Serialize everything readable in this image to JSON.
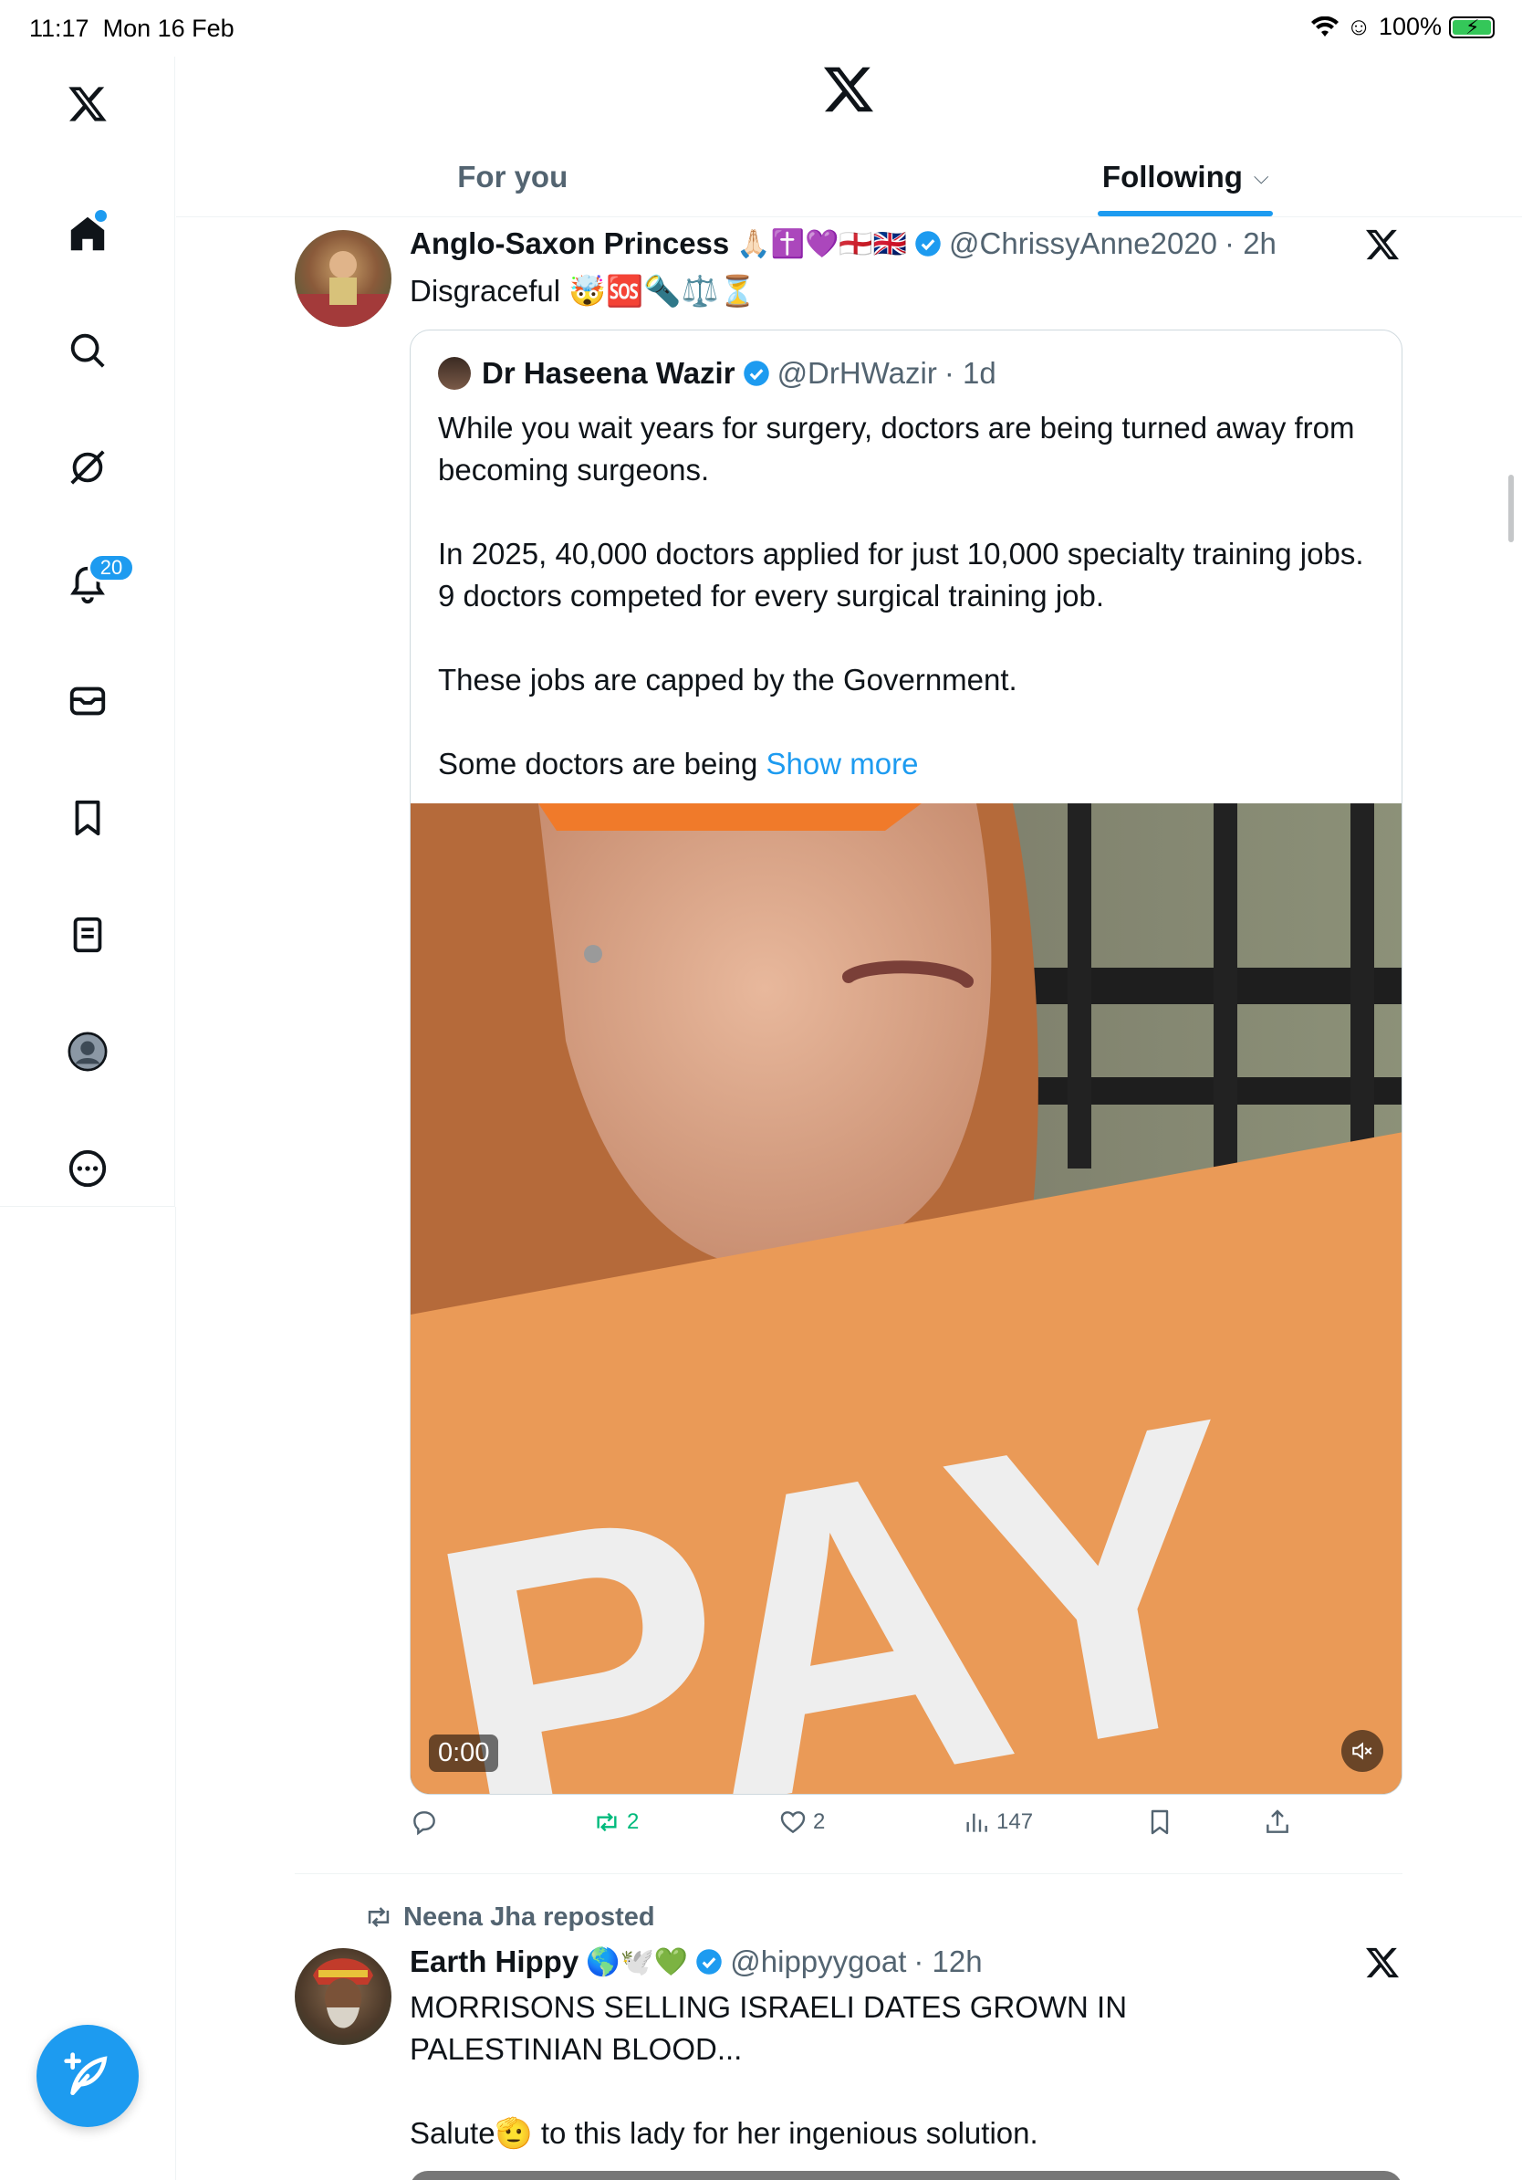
{
  "status_bar": {
    "time": "11:17",
    "date": "Mon 16 Feb",
    "battery": "100%"
  },
  "sidebar": {
    "notifications_badge": "20",
    "items": [
      {
        "icon": "home-icon"
      },
      {
        "icon": "search-icon"
      },
      {
        "icon": "grok-icon"
      },
      {
        "icon": "bell-icon"
      },
      {
        "icon": "mail-icon"
      },
      {
        "icon": "bookmark-icon"
      },
      {
        "icon": "list-icon"
      },
      {
        "icon": "profile-icon"
      },
      {
        "icon": "more-icon"
      }
    ]
  },
  "tabs": [
    {
      "label": "For you",
      "active": false
    },
    {
      "label": "Following",
      "active": true
    }
  ],
  "tweets": [
    {
      "name": "Anglo-Saxon Princess",
      "name_emojis": "🙏🏻✝️💜🏴󠁧󠁢󠁥󠁮󠁧󠁿🇬🇧",
      "handle": "@ChrissyAnne2020",
      "time": "· 2h",
      "text": "Disgraceful 🤯🆘🔦⚖️⏳",
      "quote": {
        "name": "Dr Haseena Wazir",
        "handle": "@DrHWazir",
        "time": "· 1d",
        "paragraphs": [
          "While you wait years for surgery, doctors are being turned away from becoming surgeons.",
          "In 2025, 40,000 doctors applied for just 10,000 specialty training jobs. 9 doctors competed for every surgical training job.",
          "These jobs are capped by the Government."
        ],
        "truncated": "Some doctors are being",
        "show_more": "Show more",
        "video": {
          "timecode": "0:00",
          "sign_text": "PAY"
        }
      },
      "actions": {
        "reposts": "2",
        "likes": "2",
        "views": "147"
      }
    },
    {
      "repost_by": "Neena Jha reposted",
      "name": "Earth Hippy",
      "name_emojis": "🌎🕊️💚",
      "handle": "@hippyygoat",
      "time": "· 12h",
      "text_line1": "MORRISONS SELLING ISRAELI DATES GROWN IN PALESTINIAN BLOOD...",
      "text_line2": "Salute🫡 to this lady for her ingenious solution."
    }
  ],
  "colors": {
    "accent": "#1d9bf0",
    "secondary_text": "#536471",
    "repost_green": "#00ba7c"
  }
}
